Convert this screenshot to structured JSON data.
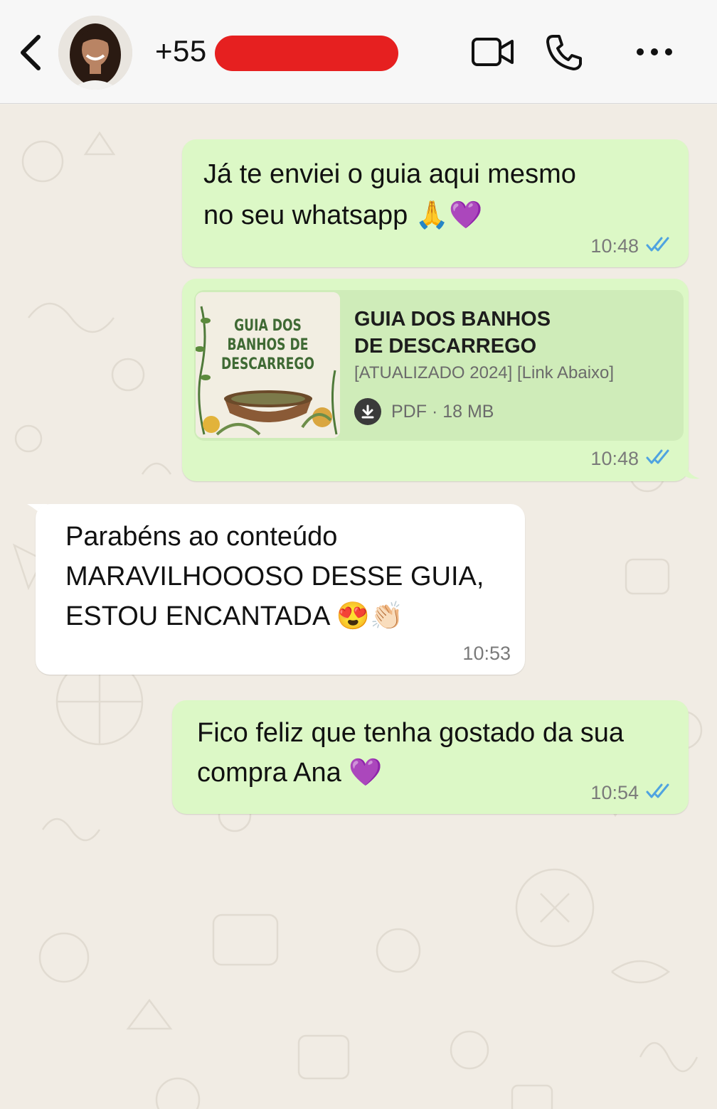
{
  "header": {
    "contact_prefix": "+55",
    "icons": [
      "back-chevron-icon",
      "video-call-icon",
      "phone-icon",
      "more-icon"
    ]
  },
  "messages": [
    {
      "direction": "outgoing",
      "text": "Já te enviei o guia aqui mesmo\nno seu whatsapp 🙏💜",
      "time": "10:48",
      "status": "read"
    },
    {
      "direction": "outgoing",
      "type": "document",
      "thumb_text": "GUIA DOS\nBANHOS DE\nDESCARREGO",
      "title": "GUIA DOS BANHOS\nDE DESCARREGO",
      "subtitle": "[ATUALIZADO 2024] [Link Abaixo]",
      "file_info": "PDF · 18 MB",
      "time": "10:48",
      "status": "read"
    },
    {
      "direction": "incoming",
      "text": "Parabéns ao conteúdo\nMARAVILHOOOSO DESSE GUIA,\nESTOU ENCANTADA 😍👏🏻",
      "time": "10:53"
    },
    {
      "direction": "outgoing",
      "text": "Fico feliz que tenha gostado da sua\ncompra Ana 💜",
      "time": "10:54",
      "status": "read"
    }
  ],
  "colors": {
    "outgoing_bubble": "#dcf8c6",
    "incoming_bubble": "#ffffff",
    "read_ticks": "#4fa3e0",
    "redaction": "#e62020"
  }
}
